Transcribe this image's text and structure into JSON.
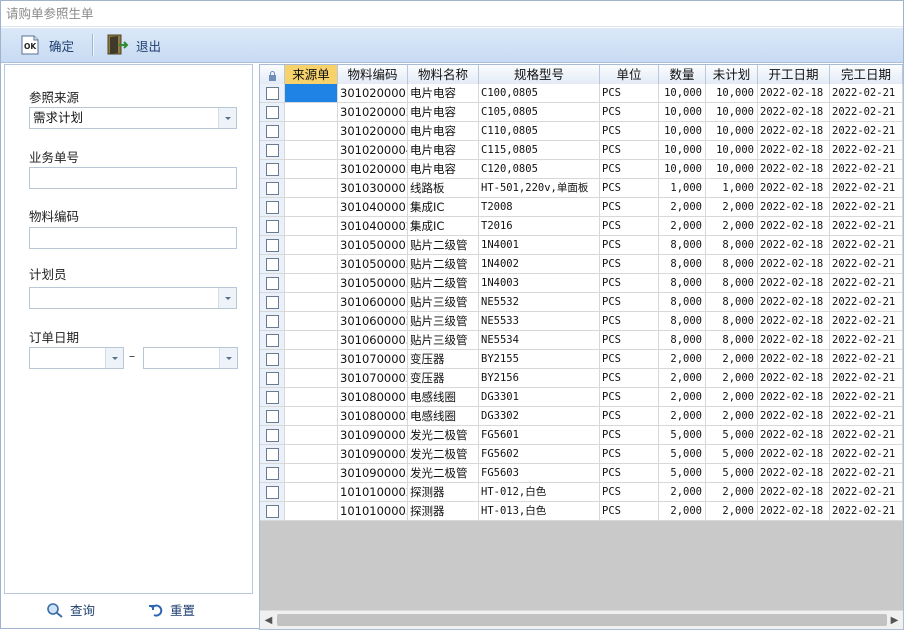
{
  "window": {
    "title": "请购单参照生单"
  },
  "toolbar": {
    "ok_label": "确定",
    "ok_icon_text": "OK",
    "exit_label": "退出"
  },
  "filters": {
    "source_label": "参照来源",
    "source_value": "需求计划",
    "order_no_label": "业务单号",
    "order_no_value": "",
    "material_label": "物料编码",
    "material_value": "",
    "planner_label": "计划员",
    "planner_value": "",
    "date_label": "订单日期",
    "date_from": "",
    "date_to": "",
    "date_sep": "–"
  },
  "actions": {
    "query_label": "查询",
    "reset_label": "重置"
  },
  "grid": {
    "columns": [
      "来源单",
      "物料编码",
      "物料名称",
      "规格型号",
      "单位",
      "数量",
      "未计划",
      "开工日期",
      "完工日期"
    ],
    "rows": [
      [
        "",
        "3010200001",
        "电片电容",
        "C100,0805",
        "PCS",
        "10,000",
        "10,000",
        "2022-02-18",
        "2022-02-21"
      ],
      [
        "",
        "3010200002",
        "电片电容",
        "C105,0805",
        "PCS",
        "10,000",
        "10,000",
        "2022-02-18",
        "2022-02-21"
      ],
      [
        "",
        "3010200003",
        "电片电容",
        "C110,0805",
        "PCS",
        "10,000",
        "10,000",
        "2022-02-18",
        "2022-02-21"
      ],
      [
        "",
        "3010200004",
        "电片电容",
        "C115,0805",
        "PCS",
        "10,000",
        "10,000",
        "2022-02-18",
        "2022-02-21"
      ],
      [
        "",
        "3010200005",
        "电片电容",
        "C120,0805",
        "PCS",
        "10,000",
        "10,000",
        "2022-02-18",
        "2022-02-21"
      ],
      [
        "",
        "3010300001",
        "线路板",
        "HT-501,220v,单面板",
        "PCS",
        "1,000",
        "1,000",
        "2022-02-18",
        "2022-02-21"
      ],
      [
        "",
        "3010400001",
        "集成IC",
        "T2008",
        "PCS",
        "2,000",
        "2,000",
        "2022-02-18",
        "2022-02-21"
      ],
      [
        "",
        "3010400002",
        "集成IC",
        "T2016",
        "PCS",
        "2,000",
        "2,000",
        "2022-02-18",
        "2022-02-21"
      ],
      [
        "",
        "3010500001",
        "贴片二级管",
        "1N4001",
        "PCS",
        "8,000",
        "8,000",
        "2022-02-18",
        "2022-02-21"
      ],
      [
        "",
        "3010500002",
        "贴片二级管",
        "1N4002",
        "PCS",
        "8,000",
        "8,000",
        "2022-02-18",
        "2022-02-21"
      ],
      [
        "",
        "3010500003",
        "贴片二级管",
        "1N4003",
        "PCS",
        "8,000",
        "8,000",
        "2022-02-18",
        "2022-02-21"
      ],
      [
        "",
        "3010600001",
        "贴片三级管",
        "NE5532",
        "PCS",
        "8,000",
        "8,000",
        "2022-02-18",
        "2022-02-21"
      ],
      [
        "",
        "3010600002",
        "贴片三级管",
        "NE5533",
        "PCS",
        "8,000",
        "8,000",
        "2022-02-18",
        "2022-02-21"
      ],
      [
        "",
        "3010600003",
        "贴片三级管",
        "NE5534",
        "PCS",
        "8,000",
        "8,000",
        "2022-02-18",
        "2022-02-21"
      ],
      [
        "",
        "3010700001",
        "变压器",
        "BY2155",
        "PCS",
        "2,000",
        "2,000",
        "2022-02-18",
        "2022-02-21"
      ],
      [
        "",
        "3010700002",
        "变压器",
        "BY2156",
        "PCS",
        "2,000",
        "2,000",
        "2022-02-18",
        "2022-02-21"
      ],
      [
        "",
        "3010800001",
        "电感线圈",
        "DG3301",
        "PCS",
        "2,000",
        "2,000",
        "2022-02-18",
        "2022-02-21"
      ],
      [
        "",
        "3010800002",
        "电感线圈",
        "DG3302",
        "PCS",
        "2,000",
        "2,000",
        "2022-02-18",
        "2022-02-21"
      ],
      [
        "",
        "3010900001",
        "发光二极管",
        "FG5601",
        "PCS",
        "5,000",
        "5,000",
        "2022-02-18",
        "2022-02-21"
      ],
      [
        "",
        "3010900002",
        "发光二极管",
        "FG5602",
        "PCS",
        "5,000",
        "5,000",
        "2022-02-18",
        "2022-02-21"
      ],
      [
        "",
        "3010900003",
        "发光二极管",
        "FG5603",
        "PCS",
        "5,000",
        "5,000",
        "2022-02-18",
        "2022-02-21"
      ],
      [
        "",
        "1010100002",
        "探测器",
        "HT-012,白色",
        "PCS",
        "2,000",
        "2,000",
        "2022-02-18",
        "2022-02-21"
      ],
      [
        "",
        "1010100003",
        "探测器",
        "HT-013,白色",
        "PCS",
        "2,000",
        "2,000",
        "2022-02-18",
        "2022-02-21"
      ]
    ]
  },
  "colors": {
    "selected_cell": "#1f83e6",
    "active_header": "#f7d26a",
    "toolbar": "#c8dbf3"
  }
}
